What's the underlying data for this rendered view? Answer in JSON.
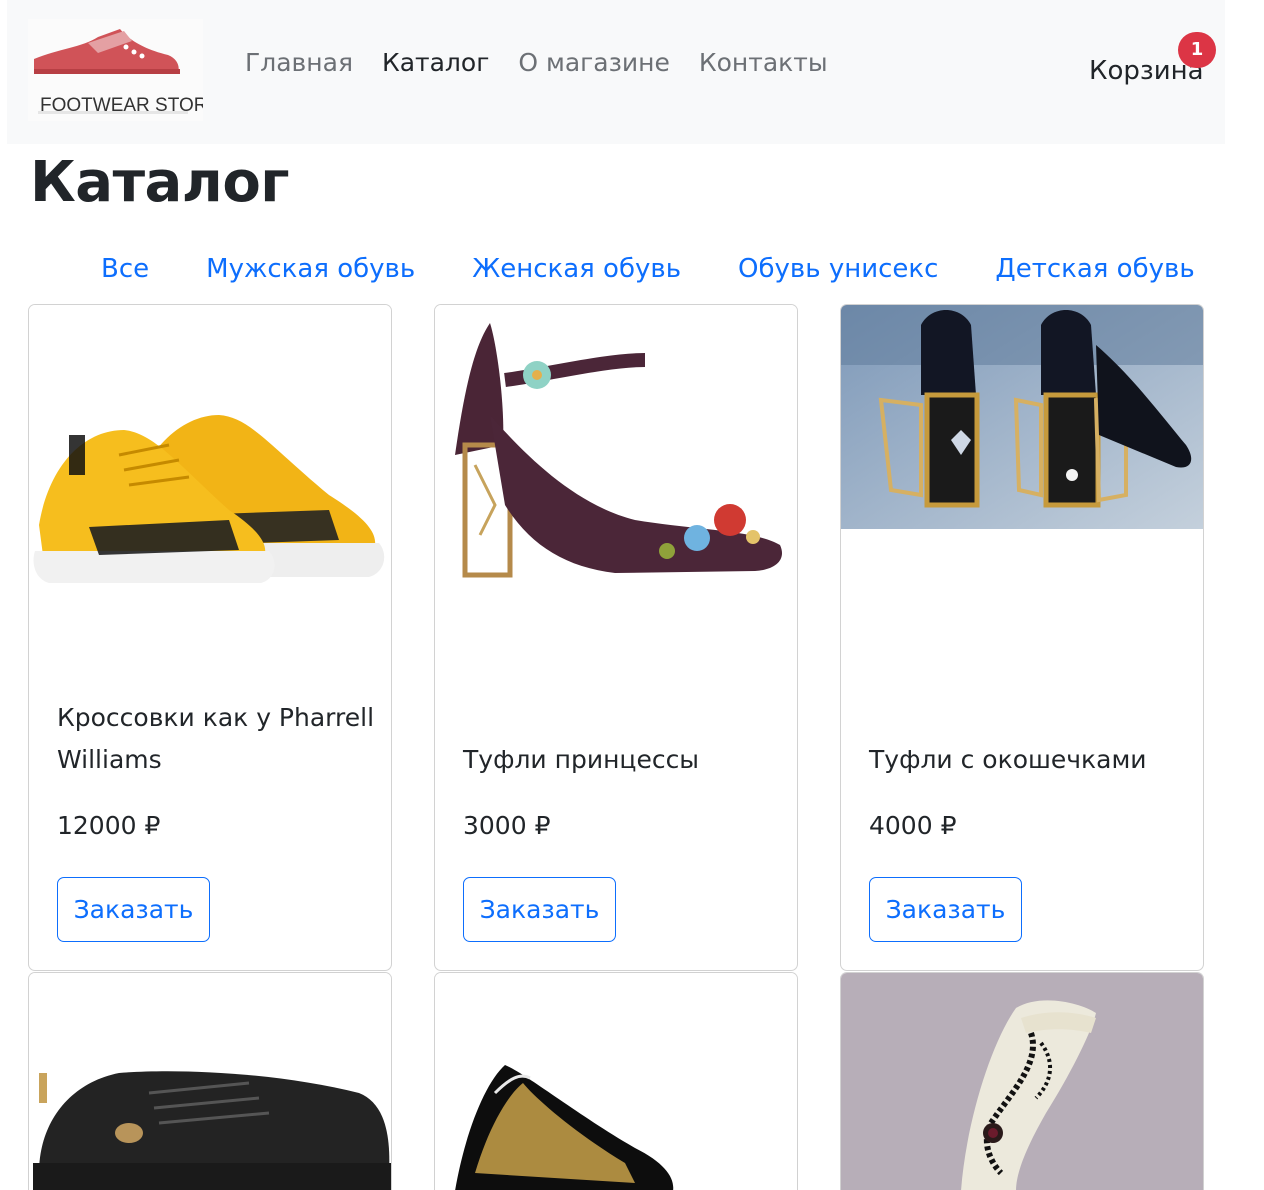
{
  "header": {
    "logo_text": "FOOTWEAR STORE",
    "nav": [
      {
        "label": "Главная",
        "active": false
      },
      {
        "label": "Каталог",
        "active": true
      },
      {
        "label": "О магазине",
        "active": false
      },
      {
        "label": "Контакты",
        "active": false
      }
    ],
    "cart_label": "Корзина",
    "cart_count": "1"
  },
  "page_title": "Каталог",
  "filters": [
    "Все",
    "Мужская обувь",
    "Женская обувь",
    "Обувь унисекс",
    "Детская обувь"
  ],
  "products": [
    {
      "title": "Кроссовки как у Pharrell Williams",
      "price": "12000 ₽",
      "button": "Заказать",
      "image": "yellow-sneakers-icon"
    },
    {
      "title": "Туфли принцессы",
      "price": "3000 ₽",
      "button": "Заказать",
      "image": "velvet-heels-icon"
    },
    {
      "title": "Туфли с окошечками",
      "price": "4000 ₽",
      "button": "Заказать",
      "image": "window-heels-icon"
    },
    {
      "image": "black-sneakers-icon"
    },
    {
      "image": "patent-pumps-icon"
    },
    {
      "image": "felt-slippers-icon"
    }
  ],
  "colors": {
    "accent": "#0d6efd",
    "badge": "#dc3545",
    "navbar_bg": "#f8f9fa"
  }
}
